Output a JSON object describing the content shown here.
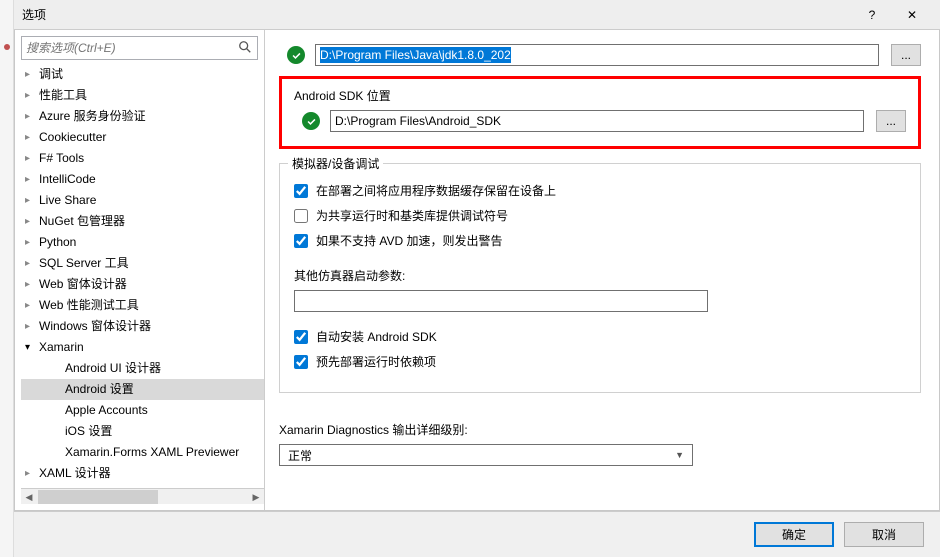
{
  "window": {
    "title": "选项",
    "help": "?",
    "close": "✕"
  },
  "search": {
    "placeholder": "搜索选项(Ctrl+E)"
  },
  "sidebar": {
    "items": [
      {
        "label": "调试",
        "expandable": true
      },
      {
        "label": "性能工具",
        "expandable": true
      },
      {
        "label": "Azure 服务身份验证",
        "expandable": true
      },
      {
        "label": "Cookiecutter",
        "expandable": true
      },
      {
        "label": "F# Tools",
        "expandable": true
      },
      {
        "label": "IntelliCode",
        "expandable": true
      },
      {
        "label": "Live Share",
        "expandable": true
      },
      {
        "label": "NuGet 包管理器",
        "expandable": true
      },
      {
        "label": "Python",
        "expandable": true
      },
      {
        "label": "SQL Server 工具",
        "expandable": true
      },
      {
        "label": "Web 窗体设计器",
        "expandable": true
      },
      {
        "label": "Web 性能测试工具",
        "expandable": true
      },
      {
        "label": "Windows 窗体设计器",
        "expandable": true
      },
      {
        "label": "Xamarin",
        "expandable": true,
        "expanded": true
      },
      {
        "label": "Android UI 设计器",
        "child": true
      },
      {
        "label": "Android 设置",
        "child": true,
        "selected": true
      },
      {
        "label": "Apple Accounts",
        "child": true
      },
      {
        "label": "iOS 设置",
        "child": true
      },
      {
        "label": "Xamarin.Forms XAML Previewer",
        "child": true
      },
      {
        "label": "XAML 设计器",
        "expandable": true
      }
    ]
  },
  "main": {
    "jdk_path": "D:\\Program Files\\Java\\jdk1.8.0_202",
    "browse_label": "...",
    "sdk_section_title": "Android SDK 位置",
    "sdk_path": "D:\\Program Files\\Android_SDK",
    "emulator_section_title": "模拟器/设备调试",
    "checks": {
      "keep_data": {
        "label": "在部署之间将应用程序数据缓存保留在设备上",
        "checked": true
      },
      "debug_symbols": {
        "label": "为共享运行时和基类库提供调试符号",
        "checked": false
      },
      "avd_warn": {
        "label": "如果不支持 AVD 加速，则发出警告",
        "checked": true
      },
      "auto_install": {
        "label": "自动安装 Android SDK",
        "checked": true
      },
      "predeploy": {
        "label": "预先部署运行时依赖项",
        "checked": true
      }
    },
    "emulator_args_label": "其他仿真器启动参数:",
    "emulator_args_value": "",
    "diagnostics_label": "Xamarin Diagnostics 输出详细级别:",
    "diagnostics_value": "正常"
  },
  "footer": {
    "ok": "确定",
    "cancel": "取消"
  }
}
